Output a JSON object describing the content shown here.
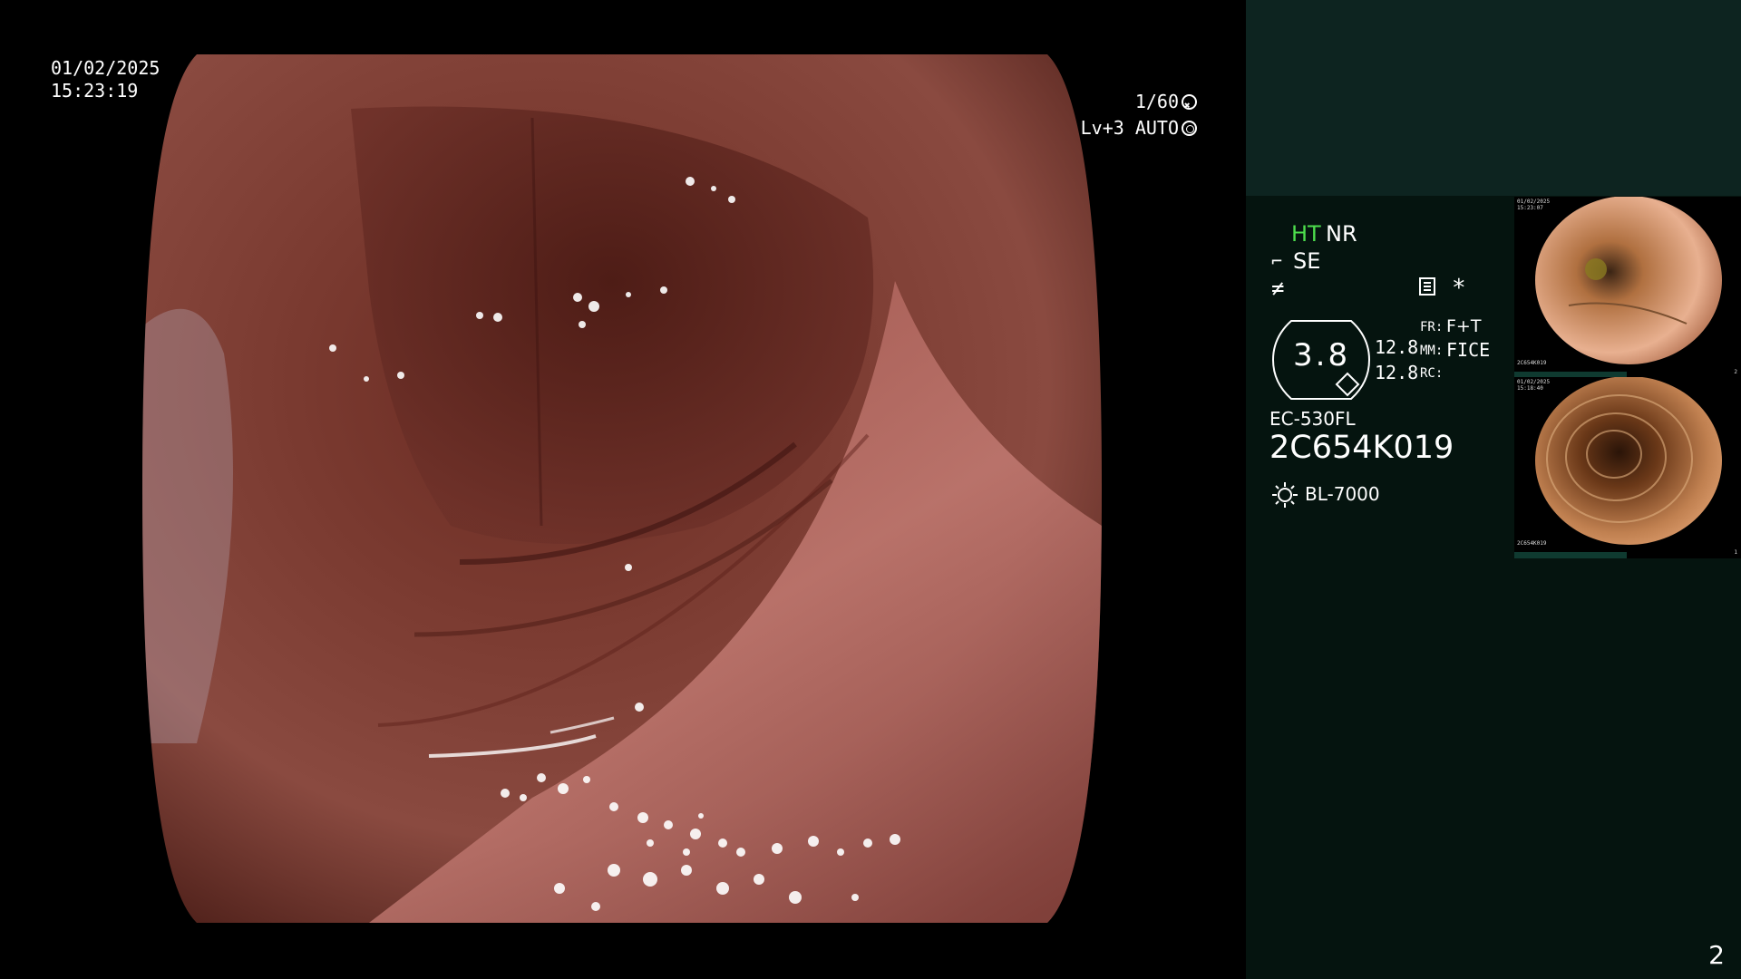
{
  "overlay": {
    "date": "01/02/2025",
    "time": "15:23:19",
    "shutter": "1/60",
    "level": "Lv+3 AUTO"
  },
  "panel": {
    "mode_ht": "HT",
    "mode_nr": "NR",
    "mode_se": "SE",
    "zoom_value": "3.8",
    "value_a": "12.8",
    "value_b": "12.8",
    "fr_label": "FR:",
    "fr_value": "F+T",
    "mm_label": "MM:",
    "mm_value": "FICE",
    "rc_label": "RC:",
    "scope_model": "EC-530FL",
    "scope_serial": "2C654K019",
    "light_source": "BL-7000",
    "page_number": "2"
  },
  "thumbnails": [
    {
      "date": "01/02/2025",
      "time": "15:23:07",
      "serial": "2C654K019",
      "index": "2"
    },
    {
      "date": "01/02/2025",
      "time": "15:18:40",
      "serial": "2C654K019",
      "index": "1"
    }
  ],
  "icons": [
    "shutter-icon",
    "iris-icon",
    "enhancement-icon",
    "flash-icon",
    "document-icon",
    "star-icon",
    "light-source-icon"
  ],
  "colors": {
    "panel_bg": "#05140f",
    "panel_top": "#0d2420",
    "ht_green": "#4ddd4d"
  }
}
